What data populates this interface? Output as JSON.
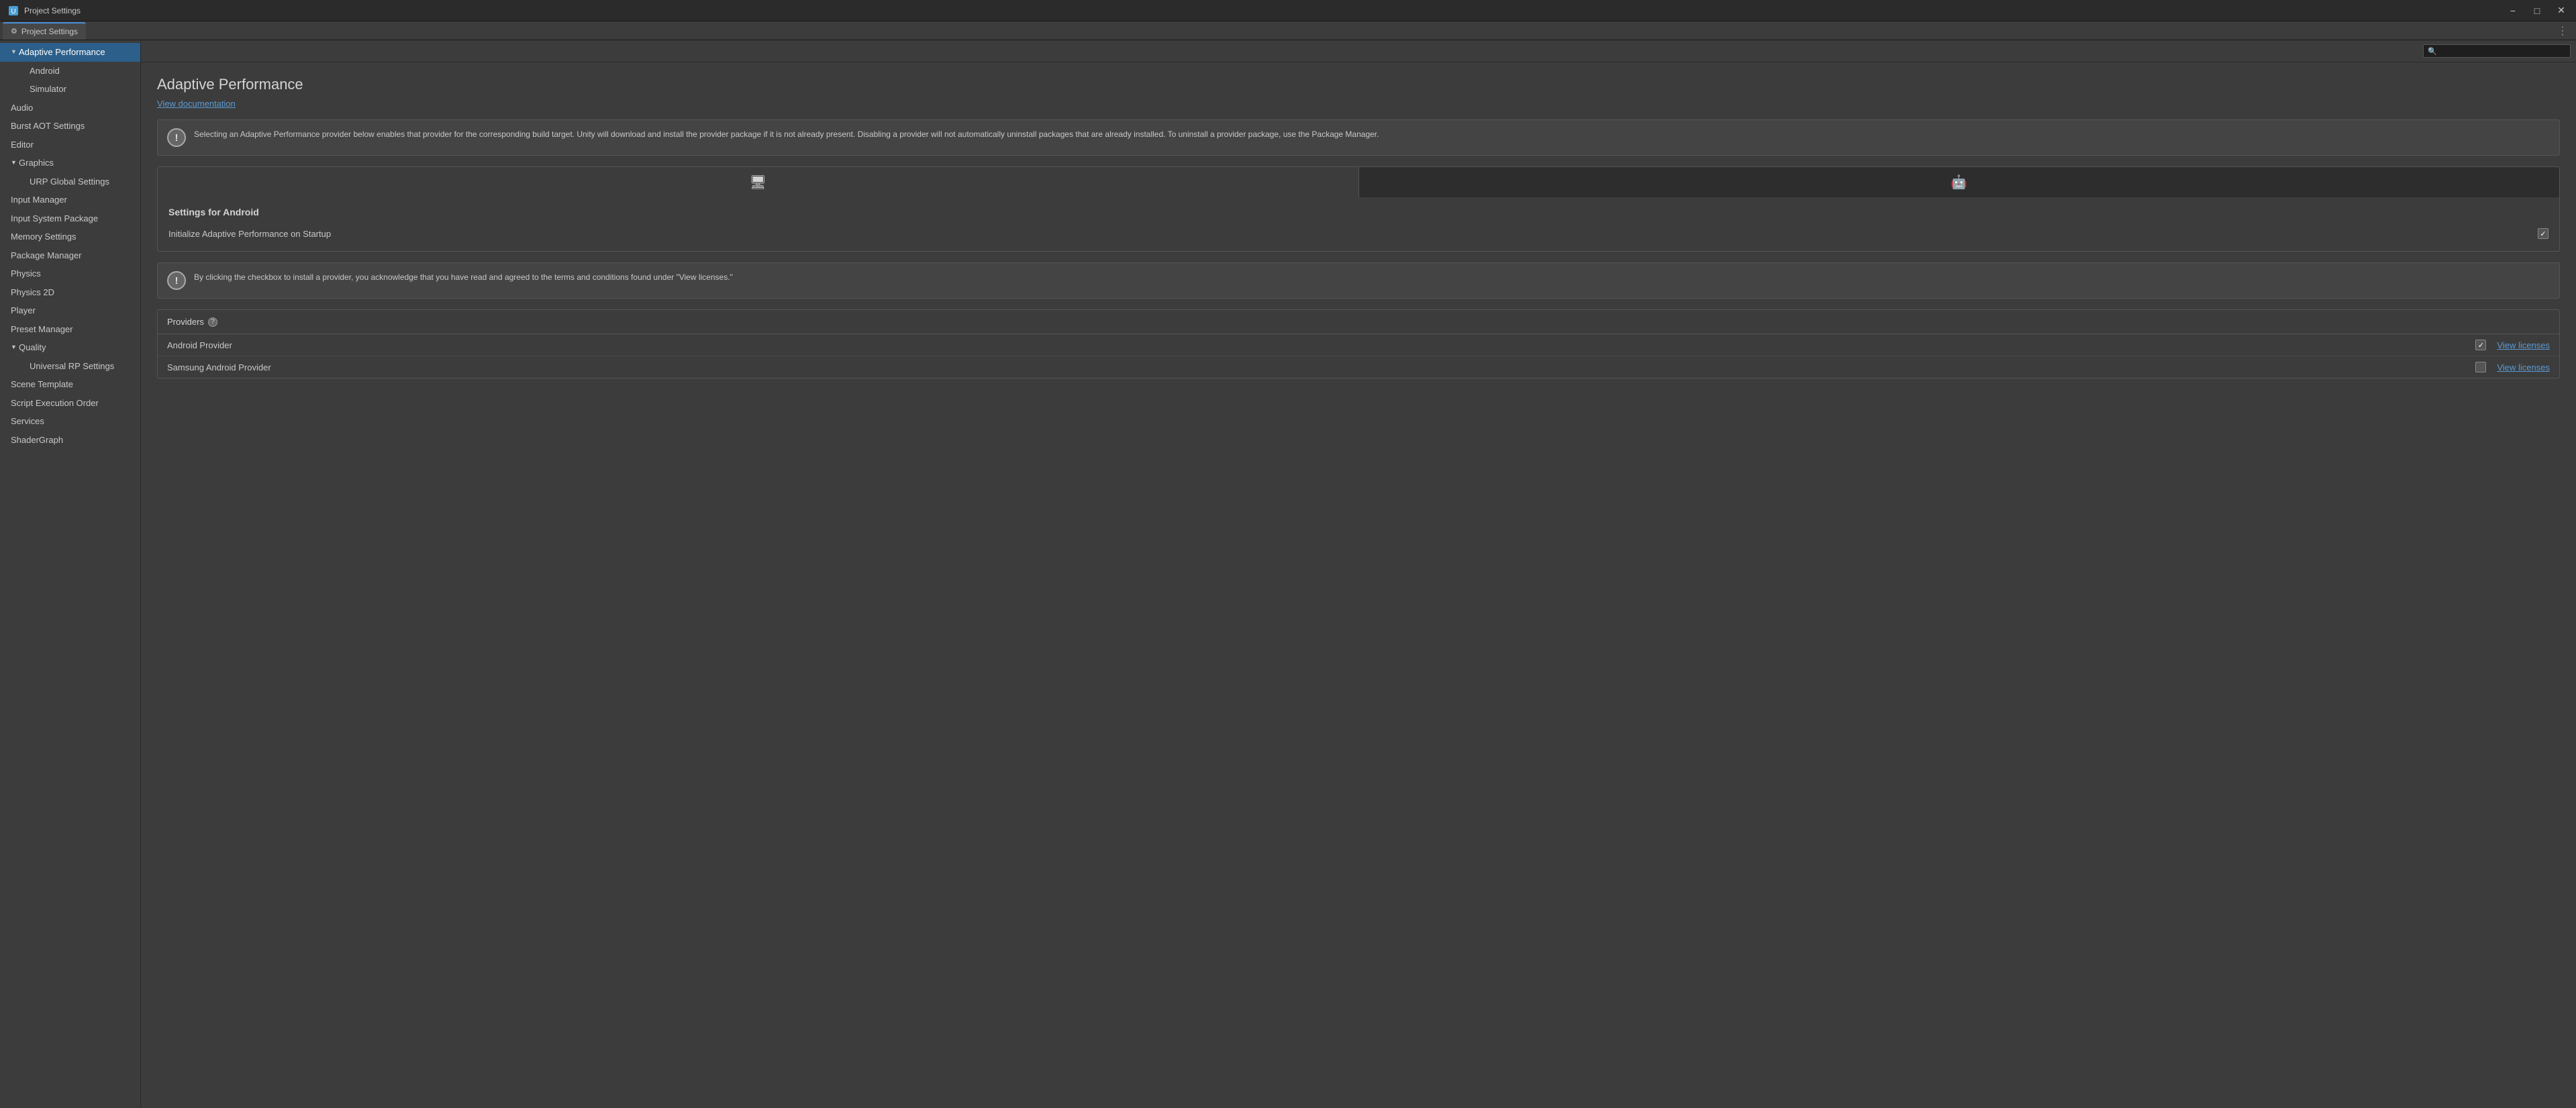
{
  "window": {
    "title": "Project Settings",
    "minimize_label": "−",
    "restore_label": "□",
    "close_label": "✕"
  },
  "tab": {
    "icon": "⚙",
    "label": "Project Settings",
    "more_icon": "⋮"
  },
  "search": {
    "placeholder": ""
  },
  "sidebar": {
    "items": [
      {
        "id": "adaptive-performance",
        "label": "Adaptive Performance",
        "indent": 0,
        "triangle": "▼",
        "active": true
      },
      {
        "id": "android",
        "label": "Android",
        "indent": 1,
        "triangle": ""
      },
      {
        "id": "simulator",
        "label": "Simulator",
        "indent": 1,
        "triangle": ""
      },
      {
        "id": "audio",
        "label": "Audio",
        "indent": 0,
        "triangle": ""
      },
      {
        "id": "burst-aot",
        "label": "Burst AOT Settings",
        "indent": 0,
        "triangle": ""
      },
      {
        "id": "editor",
        "label": "Editor",
        "indent": 0,
        "triangle": ""
      },
      {
        "id": "graphics",
        "label": "Graphics",
        "indent": 0,
        "triangle": "▼"
      },
      {
        "id": "urp-global",
        "label": "URP Global Settings",
        "indent": 1,
        "triangle": ""
      },
      {
        "id": "input-manager",
        "label": "Input Manager",
        "indent": 0,
        "triangle": ""
      },
      {
        "id": "input-system",
        "label": "Input System Package",
        "indent": 0,
        "triangle": ""
      },
      {
        "id": "memory-settings",
        "label": "Memory Settings",
        "indent": 0,
        "triangle": ""
      },
      {
        "id": "package-manager",
        "label": "Package Manager",
        "indent": 0,
        "triangle": ""
      },
      {
        "id": "physics",
        "label": "Physics",
        "indent": 0,
        "triangle": ""
      },
      {
        "id": "physics-2d",
        "label": "Physics 2D",
        "indent": 0,
        "triangle": ""
      },
      {
        "id": "player",
        "label": "Player",
        "indent": 0,
        "triangle": ""
      },
      {
        "id": "preset-manager",
        "label": "Preset Manager",
        "indent": 0,
        "triangle": ""
      },
      {
        "id": "quality",
        "label": "Quality",
        "indent": 0,
        "triangle": "▼"
      },
      {
        "id": "universal-rp",
        "label": "Universal RP Settings",
        "indent": 1,
        "triangle": ""
      },
      {
        "id": "scene-template",
        "label": "Scene Template",
        "indent": 0,
        "triangle": ""
      },
      {
        "id": "script-execution",
        "label": "Script Execution Order",
        "indent": 0,
        "triangle": ""
      },
      {
        "id": "services",
        "label": "Services",
        "indent": 0,
        "triangle": ""
      },
      {
        "id": "shadergraph",
        "label": "ShaderGraph",
        "indent": 0,
        "triangle": ""
      }
    ]
  },
  "content": {
    "title": "Adaptive Performance",
    "doc_link": "View documentation",
    "info_message": "Selecting an Adaptive Performance provider below enables that provider for the corresponding build target. Unity will download and install the provider package if it is not already present. Disabling a provider will not automatically uninstall packages that are already installed. To uninstall a provider package, use the Package Manager.",
    "platform_tabs": [
      {
        "id": "desktop",
        "icon": "🖥",
        "active": true
      },
      {
        "id": "android-tab",
        "icon": "🤖",
        "active": false
      }
    ],
    "settings_for_android": "Settings for Android",
    "initialize_label": "Initialize Adaptive Performance on Startup",
    "initialize_checked": true,
    "warning_message": "By clicking the checkbox to install a provider, you acknowledge that you have read and agreed to the terms and conditions found under \"View licenses.\"",
    "providers_label": "Providers",
    "providers": [
      {
        "id": "android-provider",
        "name": "Android Provider",
        "checked": true,
        "view_licenses": "View licenses"
      },
      {
        "id": "samsung-provider",
        "name": "Samsung Android Provider",
        "checked": false,
        "view_licenses": "View licenses"
      }
    ]
  }
}
